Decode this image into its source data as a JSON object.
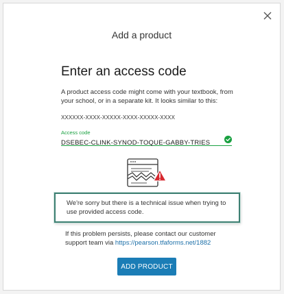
{
  "dialog": {
    "title": "Add a product",
    "close_label": "×"
  },
  "form": {
    "heading": "Enter an access code",
    "description": "A product access code might come with your textbook, from your school, or in a separate kit. It looks similar to this:",
    "code_sample": "XXXXXX-XXXX-XXXXX-XXXX-XXXXX-XXXX",
    "field_label": "Access code",
    "field_value": "DSEBEC-CLINK-SYNOD-TOQUE-GABBY-TRIES",
    "field_status_icon": "check-circle-icon"
  },
  "error": {
    "message": "We're sorry but there is a technical issue when trying to use provided access code."
  },
  "help": {
    "prefix": "If this problem persists, please contact our customer support team via ",
    "link_text": "https://pearson.tfaforms.net/1882"
  },
  "actions": {
    "add_product_label": "ADD PRODUCT"
  },
  "colors": {
    "accent_green": "#19a040",
    "primary_button": "#1b7db6",
    "error_border": "#3d7f72",
    "warning_red": "#d7282f",
    "link": "#1b6fa8"
  }
}
